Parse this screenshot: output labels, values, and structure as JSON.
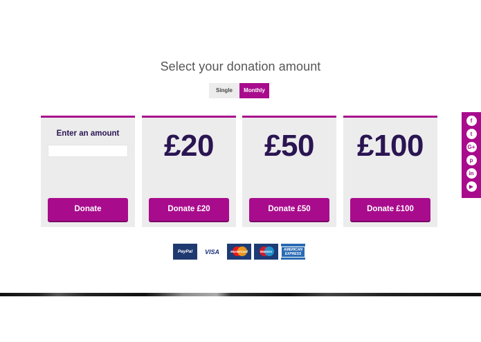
{
  "heading": "Select your donation amount",
  "frequency": {
    "options": [
      "Single",
      "Monthly"
    ],
    "selected": "Monthly"
  },
  "cards": [
    {
      "type": "custom",
      "label": "Enter an amount",
      "input_value": "",
      "button": "Donate"
    },
    {
      "type": "fixed",
      "amount": "£20",
      "button": "Donate £20"
    },
    {
      "type": "fixed",
      "amount": "£50",
      "button": "Donate £50"
    },
    {
      "type": "fixed",
      "amount": "£100",
      "button": "Donate £100"
    }
  ],
  "payment_methods": [
    {
      "name": "PayPal",
      "icon": "paypal-logo"
    },
    {
      "name": "VISA",
      "icon": "visa-logo"
    },
    {
      "name": "MasterCard",
      "icon": "mastercard-logo"
    },
    {
      "name": "Maestro",
      "icon": "maestro-logo"
    },
    {
      "name": "AMERICAN EXPRESS",
      "icon": "amex-logo"
    }
  ],
  "social": [
    {
      "icon": "facebook-icon",
      "glyph": "f"
    },
    {
      "icon": "twitter-icon",
      "glyph": "t"
    },
    {
      "icon": "google-plus-icon",
      "glyph": "G+"
    },
    {
      "icon": "pinterest-icon",
      "glyph": "p"
    },
    {
      "icon": "linkedin-icon",
      "glyph": "in"
    },
    {
      "icon": "youtube-icon",
      "glyph": "▶"
    }
  ],
  "colors": {
    "accent": "#a80c8c",
    "amount_text": "#2a1552",
    "card_bg": "#ececec"
  }
}
